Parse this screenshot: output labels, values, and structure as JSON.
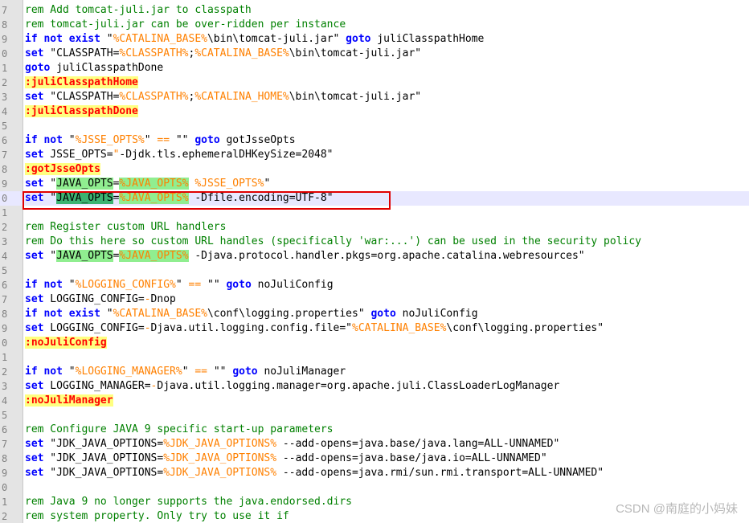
{
  "lines": [
    {
      "n": "7",
      "segs": [
        [
          "cm",
          "rem Add tomcat-juli.jar to classpath"
        ]
      ]
    },
    {
      "n": "8",
      "segs": [
        [
          "cm",
          "rem tomcat-juli.jar can be over-ridden per instance"
        ]
      ]
    },
    {
      "n": "9",
      "segs": [
        [
          "kw",
          "if not exist "
        ],
        [
          "pl",
          "\""
        ],
        [
          "var",
          "%CATALINA_BASE%"
        ],
        [
          "pl",
          "\\bin\\tomcat-juli.jar\" "
        ],
        [
          "kw",
          "goto"
        ],
        [
          "pl",
          " juliClasspathHome"
        ]
      ]
    },
    {
      "n": "0",
      "segs": [
        [
          "kw",
          "set"
        ],
        [
          "pl",
          " \"CLASSPATH="
        ],
        [
          "var",
          "%CLASSPATH%"
        ],
        [
          "pl",
          ";"
        ],
        [
          "var",
          "%CATALINA_BASE%"
        ],
        [
          "pl",
          "\\bin\\tomcat-juli.jar\""
        ]
      ]
    },
    {
      "n": "1",
      "segs": [
        [
          "kw",
          "goto"
        ],
        [
          "pl",
          " juliClasspathDone"
        ]
      ]
    },
    {
      "n": "2",
      "segs": [
        [
          "lbl",
          ":juliClasspathHome"
        ]
      ]
    },
    {
      "n": "3",
      "segs": [
        [
          "kw",
          "set"
        ],
        [
          "pl",
          " \"CLASSPATH="
        ],
        [
          "var",
          "%CLASSPATH%"
        ],
        [
          "pl",
          ";"
        ],
        [
          "var",
          "%CATALINA_HOME%"
        ],
        [
          "pl",
          "\\bin\\tomcat-juli.jar\""
        ]
      ]
    },
    {
      "n": "4",
      "segs": [
        [
          "lbl",
          ":juliClasspathDone"
        ]
      ]
    },
    {
      "n": "5",
      "segs": []
    },
    {
      "n": "6",
      "segs": [
        [
          "kw",
          "if not"
        ],
        [
          "pl",
          " \""
        ],
        [
          "var",
          "%JSSE_OPTS%"
        ],
        [
          "pl",
          "\" "
        ],
        [
          "var",
          "=="
        ],
        [
          "pl",
          " \"\" "
        ],
        [
          "kw",
          "goto"
        ],
        [
          "pl",
          " gotJsseOpts"
        ]
      ]
    },
    {
      "n": "7",
      "segs": [
        [
          "kw",
          "set"
        ],
        [
          "pl",
          " JSSE_OPTS="
        ],
        [
          "var",
          "\""
        ],
        [
          "pl",
          "-Djdk.tls.ephemeralDHKeySize=2048\""
        ]
      ]
    },
    {
      "n": "8",
      "segs": [
        [
          "lbl",
          ":gotJsseOpts"
        ]
      ]
    },
    {
      "n": "9",
      "segs": [
        [
          "kw",
          "set"
        ],
        [
          "pl",
          " \""
        ],
        [
          "hlg",
          "JAVA_OPTS"
        ],
        [
          "pl",
          "="
        ],
        [
          "hlvar",
          "%JAVA_OPTS%"
        ],
        [
          "pl",
          " "
        ],
        [
          "var",
          "%JSSE_OPTS%"
        ],
        [
          "pl",
          "\""
        ]
      ]
    },
    {
      "n": "0",
      "current": true,
      "segs": [
        [
          "kw",
          "set"
        ],
        [
          "pl",
          " \""
        ],
        [
          "hlsel",
          "JAVA_OPTS"
        ],
        [
          "pl",
          "="
        ],
        [
          "hlvar",
          "%JAVA_OPTS%"
        ],
        [
          "pl",
          " -Dfile.encoding=UTF-8\""
        ]
      ]
    },
    {
      "n": "1",
      "segs": []
    },
    {
      "n": "2",
      "segs": [
        [
          "cm",
          "rem Register custom URL handlers"
        ]
      ]
    },
    {
      "n": "3",
      "segs": [
        [
          "cm",
          "rem Do this here so custom URL handles (specifically 'war:...') can be used in the security policy"
        ]
      ]
    },
    {
      "n": "4",
      "segs": [
        [
          "kw",
          "set"
        ],
        [
          "pl",
          " \""
        ],
        [
          "hlg",
          "JAVA_OPTS"
        ],
        [
          "pl",
          "="
        ],
        [
          "hlvar",
          "%JAVA_OPTS%"
        ],
        [
          "pl",
          " -Djava.protocol.handler.pkgs=org.apache.catalina.webresources\""
        ]
      ]
    },
    {
      "n": "5",
      "segs": []
    },
    {
      "n": "6",
      "segs": [
        [
          "kw",
          "if not"
        ],
        [
          "pl",
          " \""
        ],
        [
          "var",
          "%LOGGING_CONFIG%"
        ],
        [
          "pl",
          "\" "
        ],
        [
          "var",
          "=="
        ],
        [
          "pl",
          " \"\" "
        ],
        [
          "kw",
          "goto"
        ],
        [
          "pl",
          " noJuliConfig"
        ]
      ]
    },
    {
      "n": "7",
      "segs": [
        [
          "kw",
          "set"
        ],
        [
          "pl",
          " LOGGING_CONFIG="
        ],
        [
          "var",
          "-"
        ],
        [
          "pl",
          "Dnop"
        ]
      ]
    },
    {
      "n": "8",
      "segs": [
        [
          "kw",
          "if not exist"
        ],
        [
          "pl",
          " \""
        ],
        [
          "var",
          "%CATALINA_BASE%"
        ],
        [
          "pl",
          "\\conf\\logging.properties\" "
        ],
        [
          "kw",
          "goto"
        ],
        [
          "pl",
          " noJuliConfig"
        ]
      ]
    },
    {
      "n": "9",
      "segs": [
        [
          "kw",
          "set"
        ],
        [
          "pl",
          " LOGGING_CONFIG="
        ],
        [
          "var",
          "-"
        ],
        [
          "pl",
          "Djava.util.logging.config.file=\""
        ],
        [
          "var",
          "%CATALINA_BASE%"
        ],
        [
          "pl",
          "\\conf\\logging.properties\""
        ]
      ]
    },
    {
      "n": "0",
      "segs": [
        [
          "lbl",
          ":noJuliConfig"
        ]
      ]
    },
    {
      "n": "1",
      "segs": []
    },
    {
      "n": "2",
      "segs": [
        [
          "kw",
          "if not"
        ],
        [
          "pl",
          " \""
        ],
        [
          "var",
          "%LOGGING_MANAGER%"
        ],
        [
          "pl",
          "\" "
        ],
        [
          "var",
          "=="
        ],
        [
          "pl",
          " \"\" "
        ],
        [
          "kw",
          "goto"
        ],
        [
          "pl",
          " noJuliManager"
        ]
      ]
    },
    {
      "n": "3",
      "segs": [
        [
          "kw",
          "set"
        ],
        [
          "pl",
          " LOGGING_MANAGER="
        ],
        [
          "var",
          "-"
        ],
        [
          "pl",
          "Djava.util.logging.manager=org.apache.juli.ClassLoaderLogManager"
        ]
      ]
    },
    {
      "n": "4",
      "segs": [
        [
          "lbl",
          ":noJuliManager"
        ]
      ]
    },
    {
      "n": "5",
      "segs": []
    },
    {
      "n": "6",
      "segs": [
        [
          "cm",
          "rem Configure JAVA 9 specific start-up parameters"
        ]
      ]
    },
    {
      "n": "7",
      "segs": [
        [
          "kw",
          "set"
        ],
        [
          "pl",
          " \"JDK_JAVA_OPTIONS="
        ],
        [
          "var",
          "%JDK_JAVA_OPTIONS%"
        ],
        [
          "pl",
          " --add-opens=java.base/java.lang=ALL-UNNAMED\""
        ]
      ]
    },
    {
      "n": "8",
      "segs": [
        [
          "kw",
          "set"
        ],
        [
          "pl",
          " \"JDK_JAVA_OPTIONS="
        ],
        [
          "var",
          "%JDK_JAVA_OPTIONS%"
        ],
        [
          "pl",
          " --add-opens=java.base/java.io=ALL-UNNAMED\""
        ]
      ]
    },
    {
      "n": "9",
      "segs": [
        [
          "kw",
          "set"
        ],
        [
          "pl",
          " \"JDK_JAVA_OPTIONS="
        ],
        [
          "var",
          "%JDK_JAVA_OPTIONS%"
        ],
        [
          "pl",
          " --add-opens=java.rmi/sun.rmi.transport=ALL-UNNAMED\""
        ]
      ]
    },
    {
      "n": "0",
      "segs": []
    },
    {
      "n": "1",
      "segs": [
        [
          "cm",
          "rem Java 9 no longer supports the java.endorsed.dirs"
        ]
      ]
    },
    {
      "n": "2",
      "segs": [
        [
          "cm",
          "rem system property. Only try to use it if"
        ]
      ]
    }
  ],
  "watermark": "CSDN @南庭的小妈妹",
  "colors": {
    "keyword": "#0000ff",
    "comment": "#008000",
    "variable": "#ff8000",
    "label_bg": "#ffff80",
    "highlight_box": "#e00000"
  }
}
